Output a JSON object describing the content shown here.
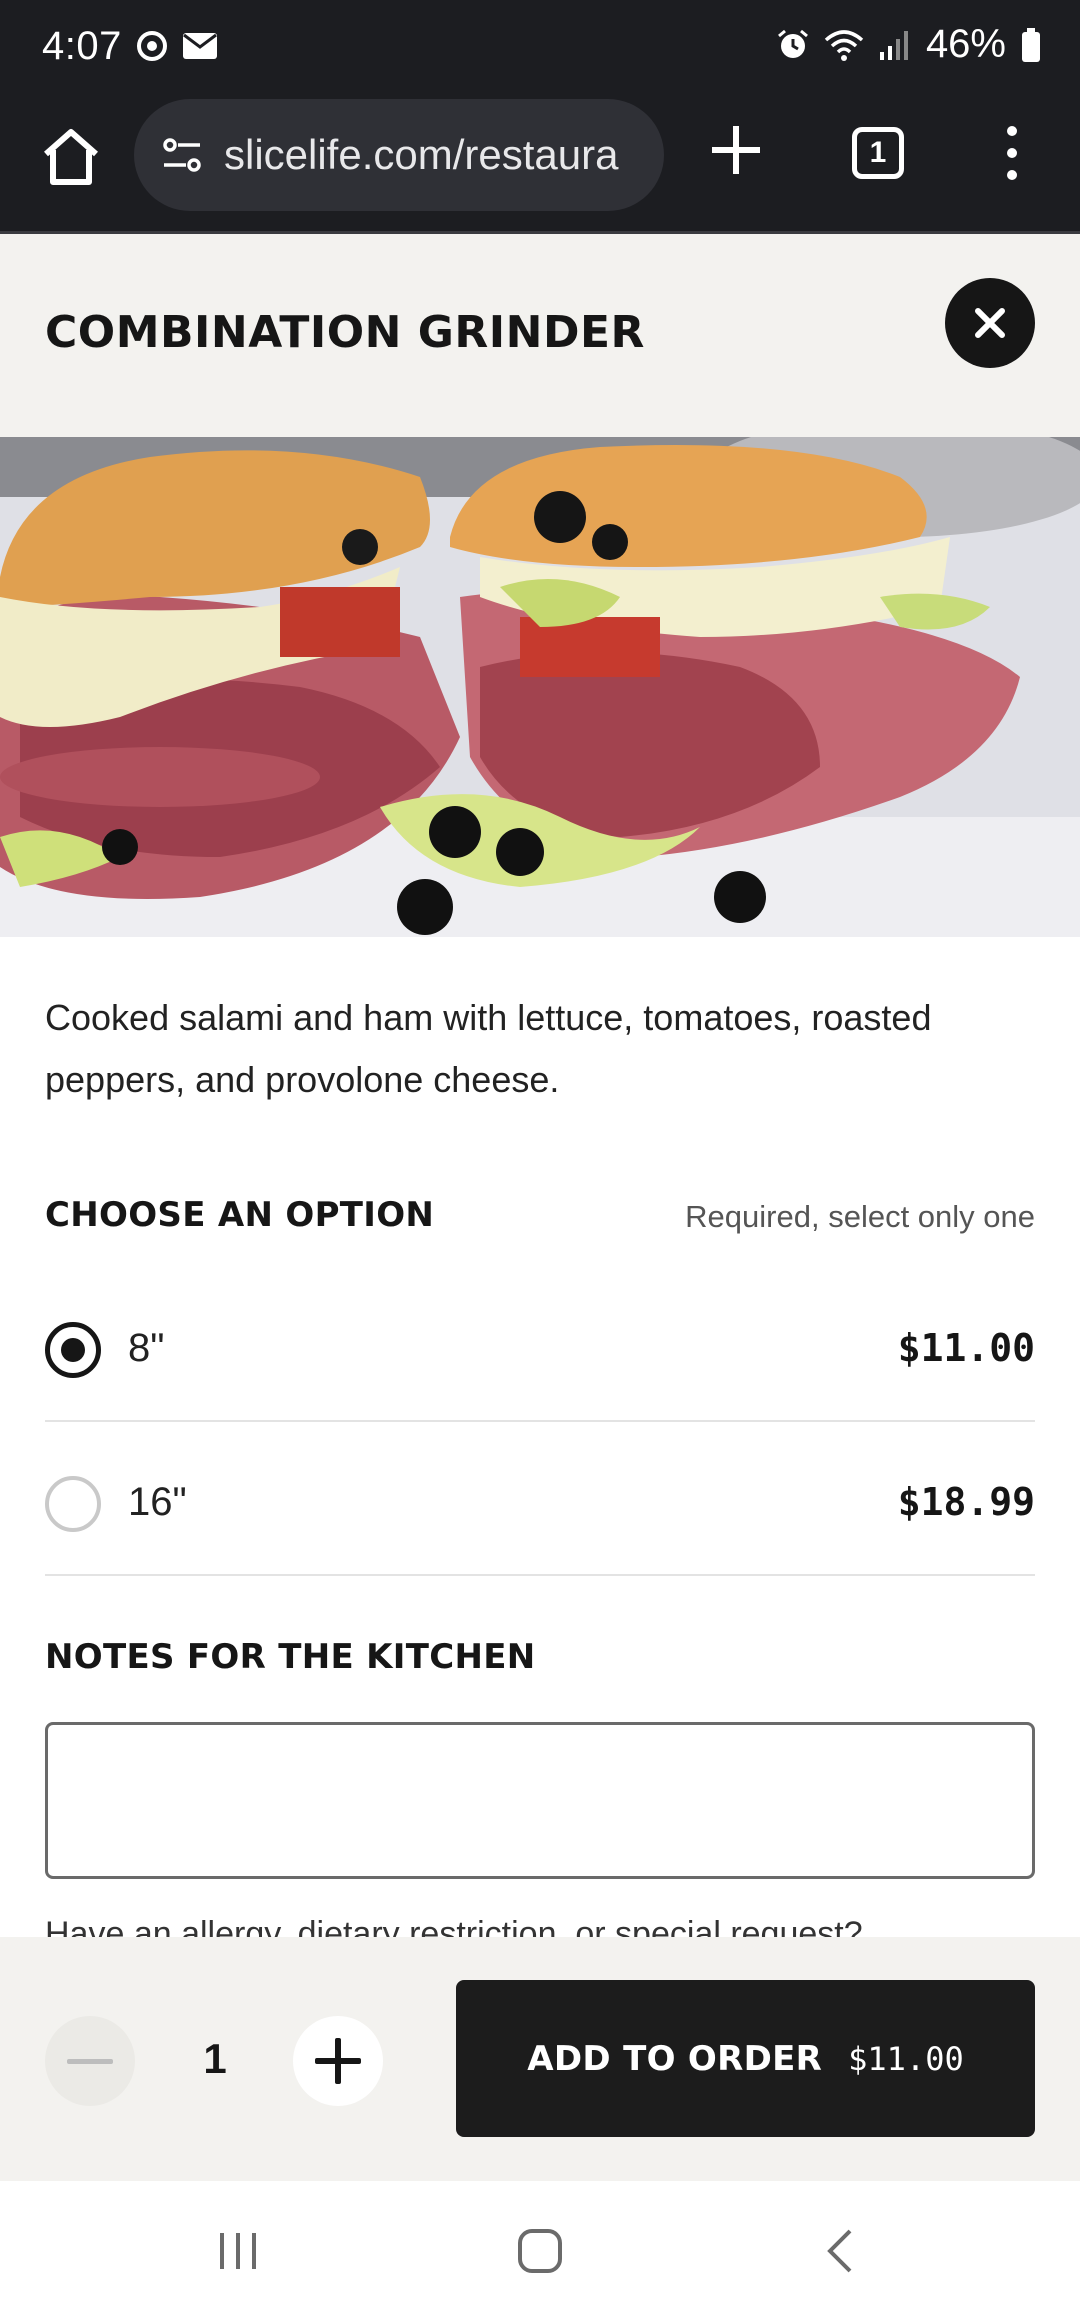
{
  "status_bar": {
    "time": "4:07",
    "battery": "46%"
  },
  "browser": {
    "url": "slicelife.com/restaura",
    "tab_count": "1"
  },
  "item": {
    "title": "COMBINATION GRINDER",
    "image_alt": "sub-sandwich-photo",
    "description": "Cooked salami and ham with lettuce, tomatoes, roasted peppers, and provolone cheese."
  },
  "options": {
    "heading": "CHOOSE AN OPTION",
    "requirement": "Required, select only one",
    "choices": [
      {
        "label": "8\"",
        "price": "$11.00",
        "selected": true
      },
      {
        "label": "16\"",
        "price": "$18.99",
        "selected": false
      }
    ]
  },
  "notes": {
    "heading": "NOTES FOR THE KITCHEN",
    "value": "",
    "placeholder": "",
    "helper": "Have an allergy, dietary restriction, or special request?"
  },
  "footer": {
    "quantity": "1",
    "add_label": "ADD TO ORDER",
    "add_price": "$11.00"
  },
  "colors": {
    "dark": "#161616",
    "background": "#f3f2ef",
    "status_bar": "#1c1d21"
  }
}
